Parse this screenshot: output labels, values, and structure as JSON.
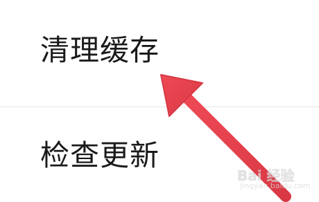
{
  "menu": {
    "items": [
      {
        "label": "清理缓存"
      },
      {
        "label": "检查更新"
      }
    ]
  },
  "annotation": {
    "arrow_color": "#e8424f",
    "points_to": "清理缓存"
  },
  "watermark": {
    "logo_text": "Bai 经验",
    "url_text": "jingyan.baidu.com"
  },
  "colors": {
    "background": "#ffffff",
    "text": "#1a1a1a",
    "divider": "#e6e6e6"
  }
}
